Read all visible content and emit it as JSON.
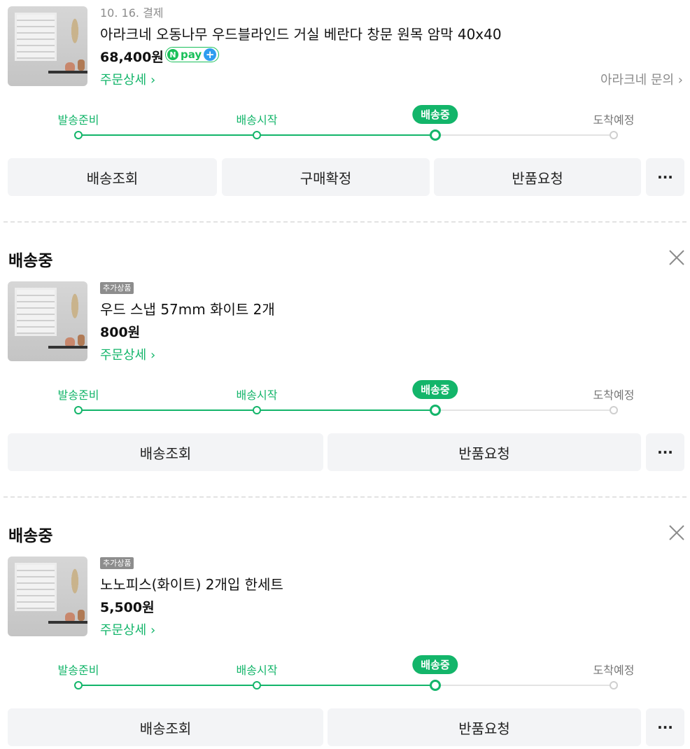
{
  "orders": [
    {
      "date": "10. 16. 결제",
      "badge": "",
      "name": "아라크네 오동나무 우드블라인드 거실 베란다 창문 원목 암막 40x40",
      "price": "68,400원",
      "npay_label": "pay",
      "detail_link": "주문상세 ›",
      "inquiry_link": "아라크네 문의 ›",
      "steps": [
        "발송준비",
        "배송시작",
        "배송중",
        "도착예정"
      ],
      "current_step": 3,
      "buttons": [
        "배송조회",
        "구매확정",
        "반품요청"
      ],
      "more_label": "···"
    },
    {
      "status_title": "배송중",
      "badge": "추가상품",
      "name": "우드 스냅 57mm 화이트 2개",
      "price": "800원",
      "detail_link": "주문상세 ›",
      "steps": [
        "발송준비",
        "배송시작",
        "배송중",
        "도착예정"
      ],
      "current_step": 3,
      "buttons": [
        "배송조회",
        "반품요청"
      ],
      "more_label": "···"
    },
    {
      "status_title": "배송중",
      "badge": "추가상품",
      "name": "노노피스(화이트) 2개입 한세트",
      "price": "5,500원",
      "detail_link": "주문상세 ›",
      "steps": [
        "발송준비",
        "배송시작",
        "배송중",
        "도착예정"
      ],
      "current_step": 3,
      "buttons": [
        "배송조회",
        "반품요청"
      ],
      "more_label": "···"
    }
  ],
  "colors": {
    "accent": "#13b56a",
    "npay_green": "#19c05a",
    "npay_blue": "#2e9df0",
    "button_bg": "#f3f4f6"
  }
}
